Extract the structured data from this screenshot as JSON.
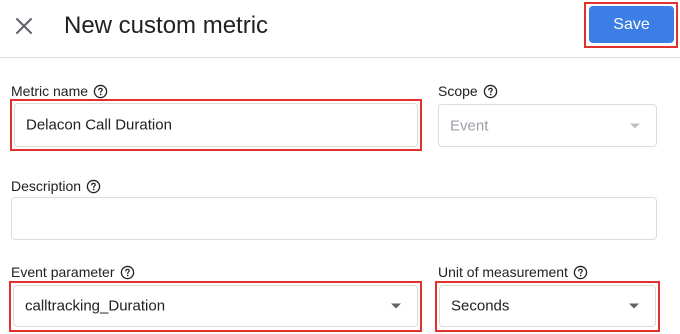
{
  "header": {
    "title": "New custom metric",
    "save_label": "Save"
  },
  "form": {
    "metric_name": {
      "label": "Metric name",
      "value": "Delacon Call Duration"
    },
    "scope": {
      "label": "Scope",
      "value": "Event"
    },
    "description": {
      "label": "Description",
      "value": ""
    },
    "event_parameter": {
      "label": "Event parameter",
      "value": "calltracking_Duration"
    },
    "unit": {
      "label": "Unit of measurement",
      "value": "Seconds"
    }
  },
  "colors": {
    "accent": "#3b7ee6",
    "highlight": "#e0312b",
    "border": "#dadce0"
  },
  "icons": {
    "close": "close-icon",
    "help": "help-circle-icon",
    "dropdown": "dropdown-arrow-icon"
  }
}
